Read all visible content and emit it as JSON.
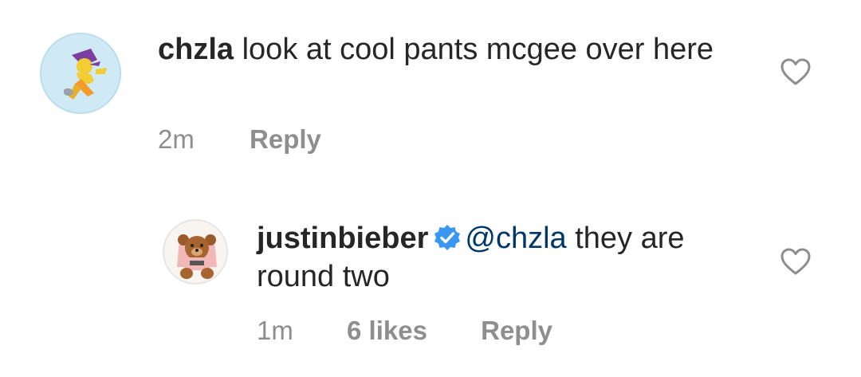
{
  "comments": [
    {
      "username": "chzla",
      "text": "look at cool pants mcgee over here",
      "time": "2m",
      "reply_label": "Reply",
      "avatar_icon": "cartoon-superhero-avatar-icon"
    },
    {
      "username": "justinbieber",
      "verified": true,
      "mention": "@chzla",
      "text": " they are round two",
      "time": "1m",
      "likes": "6 likes",
      "reply_label": "Reply",
      "avatar_icon": "teddy-bear-avatar-icon"
    }
  ],
  "colors": {
    "text": "#262626",
    "meta": "#8e8e8e",
    "mention": "#00376b",
    "verified": "#3897f0",
    "heart_stroke": "#8e8e8e"
  }
}
